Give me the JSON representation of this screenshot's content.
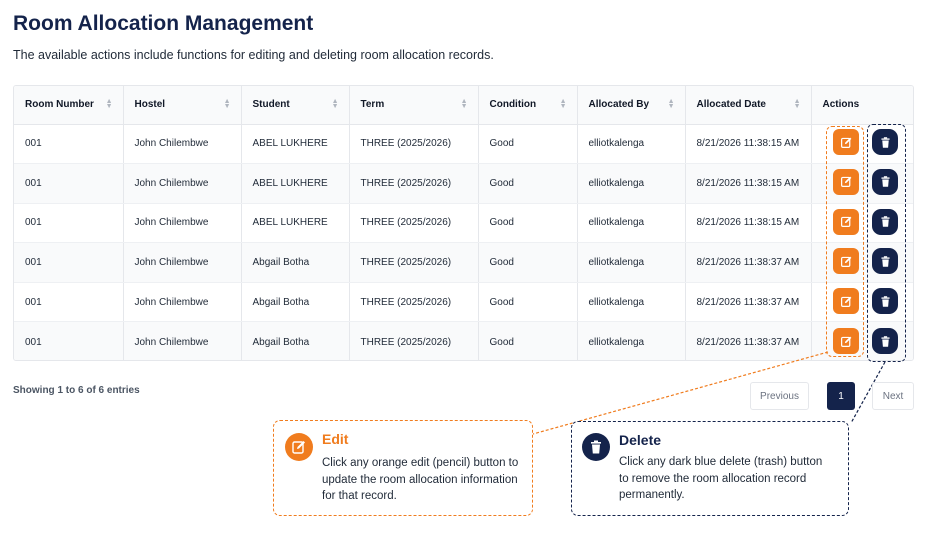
{
  "page": {
    "title": "Room Allocation Management",
    "description": "The available actions include functions for editing and deleting room allocation records."
  },
  "table": {
    "columns": [
      "Room Number",
      "Hostel",
      "Student",
      "Term",
      "Condition",
      "Allocated By",
      "Allocated Date",
      "Actions"
    ],
    "rows": [
      [
        "001",
        "John Chilembwe",
        "ABEL LUKHERE",
        "THREE (2025/2026)",
        "Good",
        "elliotkalenga",
        "8/21/2026 11:38:15 AM"
      ],
      [
        "001",
        "John Chilembwe",
        "ABEL LUKHERE",
        "THREE (2025/2026)",
        "Good",
        "elliotkalenga",
        "8/21/2026 11:38:15 AM"
      ],
      [
        "001",
        "John Chilembwe",
        "ABEL LUKHERE",
        "THREE (2025/2026)",
        "Good",
        "elliotkalenga",
        "8/21/2026 11:38:15 AM"
      ],
      [
        "001",
        "John Chilembwe",
        "Abgail Botha",
        "THREE (2025/2026)",
        "Good",
        "elliotkalenga",
        "8/21/2026 11:38:37 AM"
      ],
      [
        "001",
        "John Chilembwe",
        "Abgail Botha",
        "THREE (2025/2026)",
        "Good",
        "elliotkalenga",
        "8/21/2026 11:38:37 AM"
      ],
      [
        "001",
        "John Chilembwe",
        "Abgail Botha",
        "THREE (2025/2026)",
        "Good",
        "elliotkalenga",
        "8/21/2026 11:38:37 AM"
      ]
    ]
  },
  "footer": {
    "showing": "Showing 1 to 6 of 6 entries",
    "previous": "Previous",
    "current_page": "1",
    "next": "Next"
  },
  "callouts": {
    "edit": {
      "title": "Edit",
      "body": "Click any orange edit (pencil) button to update the room allocation information for that record.",
      "icon": "pencil-icon"
    },
    "delete": {
      "title": "Delete",
      "body": "Click any dark blue delete (trash) button to remove the room allocation record permanently.",
      "icon": "trash-icon"
    }
  },
  "colors": {
    "title_navy": "#14234b",
    "edit_orange": "#f07c1e",
    "delete_navy": "#14234b"
  }
}
